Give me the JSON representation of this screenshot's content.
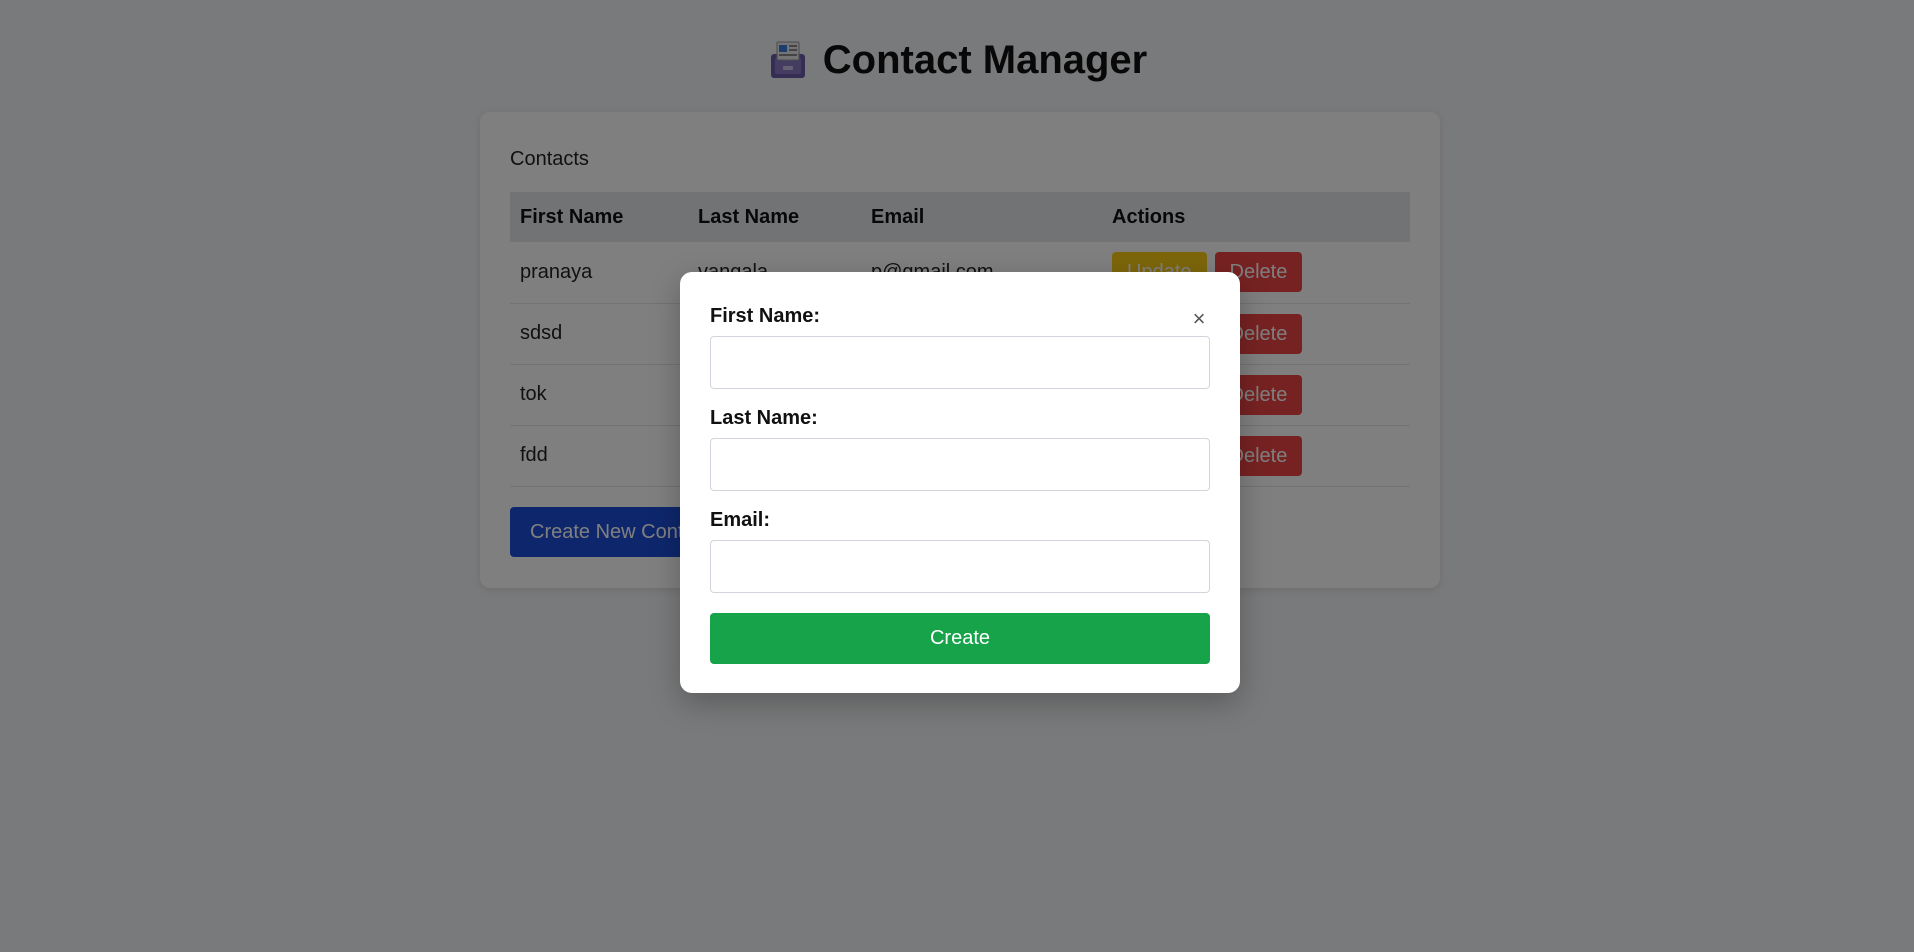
{
  "app": {
    "title": "Contact Manager",
    "logo_icon": "cardfile-box-icon"
  },
  "contacts_section": {
    "heading": "Contacts",
    "columns": [
      "First Name",
      "Last Name",
      "Email",
      "Actions"
    ],
    "rows": [
      {
        "first": "pranaya",
        "last": "vangala",
        "email": "p@gmail.com"
      },
      {
        "first": "sdsd",
        "last": "",
        "email": ""
      },
      {
        "first": "tok",
        "last": "",
        "email": ""
      },
      {
        "first": "fdd",
        "last": "",
        "email": ""
      }
    ],
    "update_label": "Update",
    "delete_label": "Delete",
    "create_new_label": "Create New Contact"
  },
  "modal": {
    "close_label": "×",
    "first_name_label": "First Name:",
    "last_name_label": "Last Name:",
    "email_label": "Email:",
    "first_name_value": "",
    "last_name_value": "",
    "email_value": "",
    "submit_label": "Create"
  },
  "colors": {
    "update_button": "#facc15",
    "delete_button": "#ef4444",
    "create_new_button": "#1d4ed8",
    "submit_button": "#16a34a",
    "overlay": "rgba(0,0,0,0.5)"
  }
}
